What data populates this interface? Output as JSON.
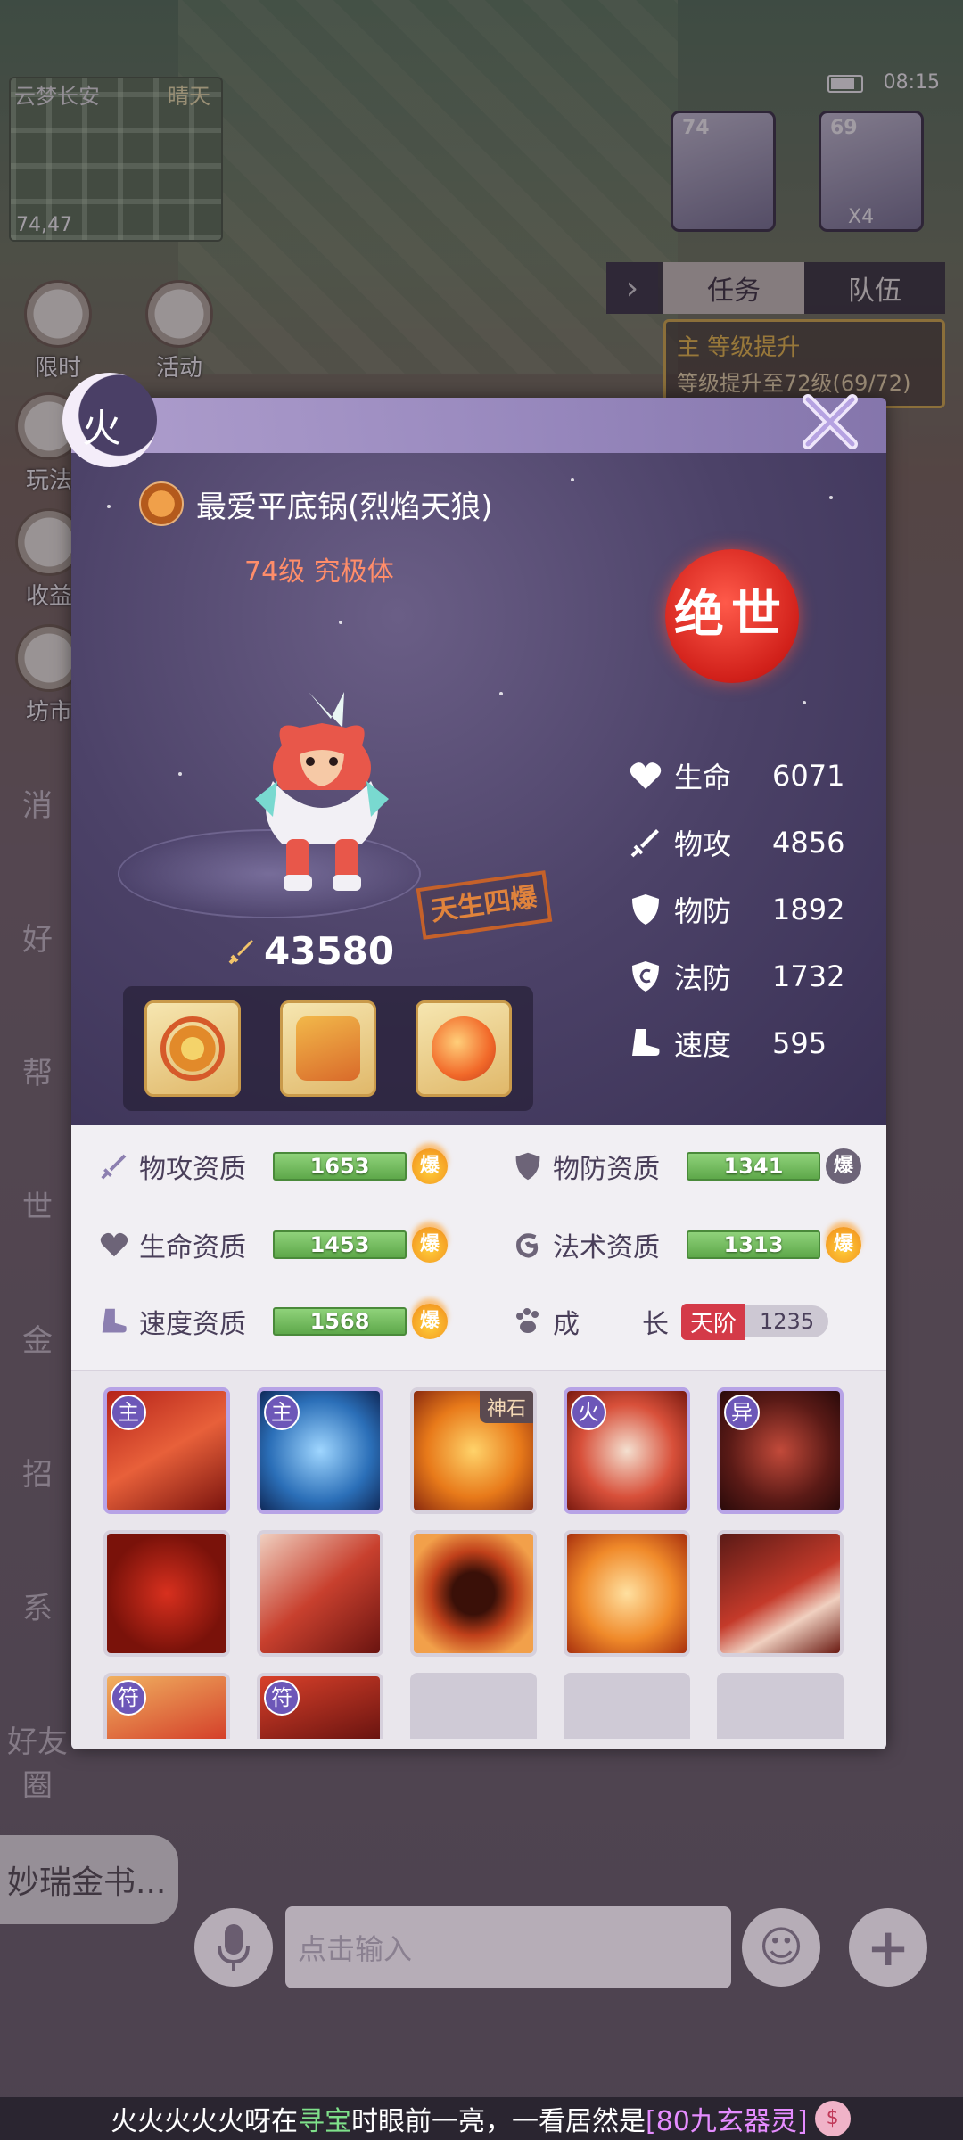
{
  "scene": {
    "minimap_location": "云梦长安",
    "minimap_weather": "晴天",
    "minimap_coords": "74,47",
    "time": "08:15",
    "team_portraits": [
      {
        "level": "74"
      },
      {
        "level": "69",
        "count": "X4"
      }
    ],
    "side_buttons": [
      "限时",
      "活动",
      "玩法",
      "收益",
      "坊市"
    ],
    "task_tabs": [
      "任务",
      "队伍"
    ],
    "task_panel": {
      "title": "主 等级提升",
      "detail": "等级提升至72级(69/72)"
    },
    "left_list": [
      "消",
      "好",
      "帮",
      "世",
      "金",
      "招",
      "系",
      "好友圈"
    ],
    "chat_chip": "妙瑞金书...",
    "input_placeholder": "点击输入",
    "marquee": {
      "player": "火火火火火呀在",
      "place": "寻宝",
      "middle": "时眼前一亮，一看居然是",
      "item": "[80九玄器灵]"
    }
  },
  "modal": {
    "element": "火",
    "pet_name": "最爱平底锅(烈焰天狼)",
    "pet_level": "74级  究极体",
    "rank": "绝世",
    "stamp": "天生四爆",
    "power": "43580",
    "stats": [
      {
        "label": "生命",
        "value": "6071",
        "icon": "heart-icon"
      },
      {
        "label": "物攻",
        "value": "4856",
        "icon": "sword-icon"
      },
      {
        "label": "物防",
        "value": "1892",
        "icon": "shield-icon"
      },
      {
        "label": "法防",
        "value": "1732",
        "icon": "magic-shield-icon"
      },
      {
        "label": "速度",
        "value": "595",
        "icon": "boot-icon"
      }
    ],
    "equipment": [
      "collar-equipment",
      "armor-equipment",
      "charm-equipment"
    ],
    "aptitudes": [
      {
        "label": "物攻资质",
        "value": "1653",
        "boom": "爆",
        "flaming": true
      },
      {
        "label": "物防资质",
        "value": "1341",
        "boom": "爆",
        "flaming": false
      },
      {
        "label": "生命资质",
        "value": "1453",
        "boom": "爆",
        "flaming": true
      },
      {
        "label": "法术资质",
        "value": "1313",
        "boom": "爆",
        "flaming": true
      },
      {
        "label": "速度资质",
        "value": "1568",
        "boom": "爆",
        "flaming": true
      }
    ],
    "growth": {
      "label_a": "成",
      "label_b": "长",
      "tier": "天阶",
      "value": "1235"
    },
    "skills": [
      {
        "tag": "主",
        "corner": "",
        "art": "claw-slash"
      },
      {
        "tag": "主",
        "corner": "",
        "art": "ice-wolf"
      },
      {
        "tag": "",
        "corner": "神石",
        "art": "fire-cat"
      },
      {
        "tag": "火",
        "corner": "",
        "art": "fire-beast"
      },
      {
        "tag": "异",
        "corner": "",
        "art": "dark-wolf"
      },
      {
        "tag": "",
        "corner": "",
        "art": "heal-cat"
      },
      {
        "tag": "",
        "corner": "",
        "art": "blood-sword"
      },
      {
        "tag": "",
        "corner": "",
        "art": "vortex-cat"
      },
      {
        "tag": "",
        "corner": "",
        "art": "flame-spirit"
      },
      {
        "tag": "",
        "corner": "",
        "art": "great-sword"
      },
      {
        "tag": "符",
        "corner": "",
        "art": "talisman-blade"
      },
      {
        "tag": "符",
        "corner": "",
        "art": "talisman-demon"
      }
    ]
  }
}
